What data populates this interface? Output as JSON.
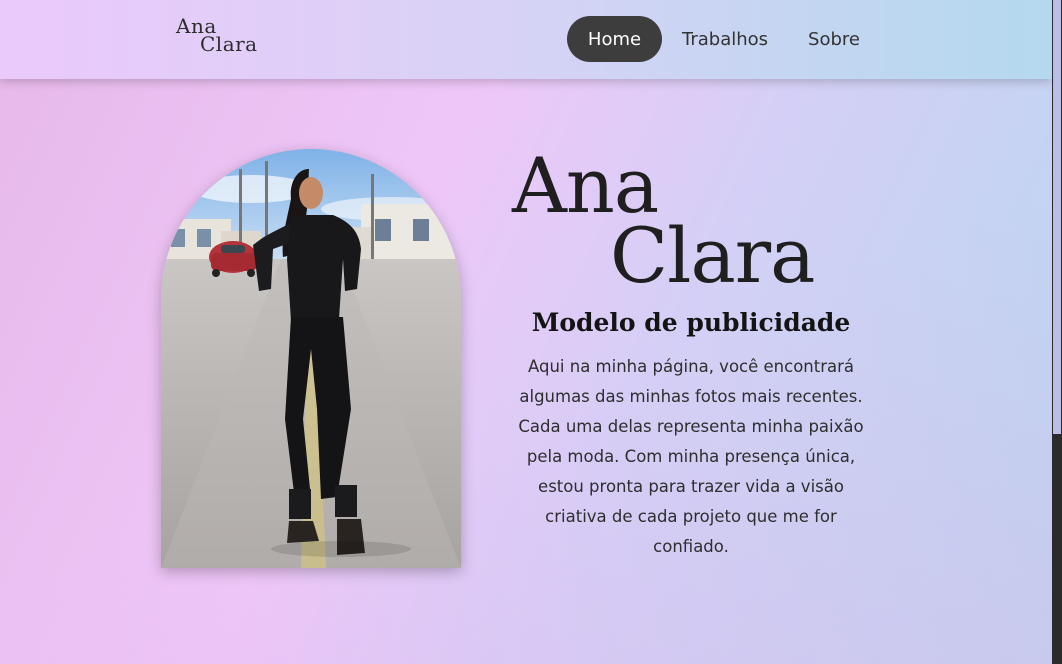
{
  "header": {
    "logo": {
      "line1": "Ana",
      "line2": "Clara"
    },
    "nav": [
      {
        "label": "Home",
        "active": true
      },
      {
        "label": "Trabalhos",
        "active": false
      },
      {
        "label": "Sobre",
        "active": false
      }
    ]
  },
  "hero": {
    "name_line1": "Ana",
    "name_line2": "Clara",
    "subtitle": "Modelo de publicidade",
    "description": "Aqui na minha página, você encontrará algumas das minhas fotos mais recentes. Cada uma delas representa minha paixão pela moda. Com minha presença única, estou pronta para trazer vida a visão criativa de cada projeto que me for confiado."
  },
  "colors": {
    "nav_active_bg": "#3d3d3d",
    "nav_active_text": "#ffffff",
    "header_gradient_start": "#ebc9fb",
    "header_gradient_end": "#b4d9ee"
  },
  "icons": {
    "photo": "model-portrait-photo"
  }
}
